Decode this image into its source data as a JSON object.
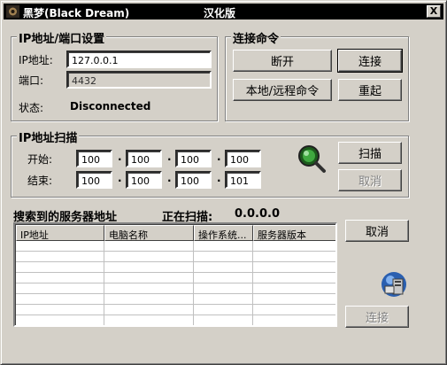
{
  "window": {
    "title_left": "黑梦(Black Dream)",
    "title_center": "汉化版",
    "close_glyph": "X"
  },
  "ip_settings": {
    "group_title": "IP地址/端口设置",
    "ip_label": "IP地址:",
    "ip_value": "127.0.0.1",
    "port_label": "端口:",
    "port_value": "4432",
    "status_label": "状态:",
    "status_value": "Disconnected"
  },
  "connect_cmds": {
    "group_title": "连接命令",
    "disconnect": "断开",
    "connect": "连接",
    "local_remote": "本地/远程命令",
    "restart": "重起"
  },
  "scan": {
    "group_title": "IP地址扫描",
    "start_label": "开始:",
    "end_label": "结束:",
    "start_ip": [
      "100",
      "100",
      "100",
      "100"
    ],
    "end_ip": [
      "100",
      "100",
      "100",
      "101"
    ],
    "separator": ".",
    "scan_button": "扫描",
    "cancel_button": "取消"
  },
  "results": {
    "heading": "搜索到的服务器地址",
    "scanning_label": "正在扫描:",
    "scanning_value": "0.0.0.0",
    "columns": [
      "IP地址",
      "电脑名称",
      "操作系统...",
      "服务器版本"
    ],
    "cancel_button": "取消",
    "connect_button": "连接"
  },
  "icons": {
    "app": "black-dream-app-icon",
    "scan": "magnifier-scan-icon",
    "server": "server-computer-icon"
  },
  "colors": {
    "face": "#d4d0c8",
    "titlebar": "#000000",
    "disabled_text": "#808080"
  }
}
